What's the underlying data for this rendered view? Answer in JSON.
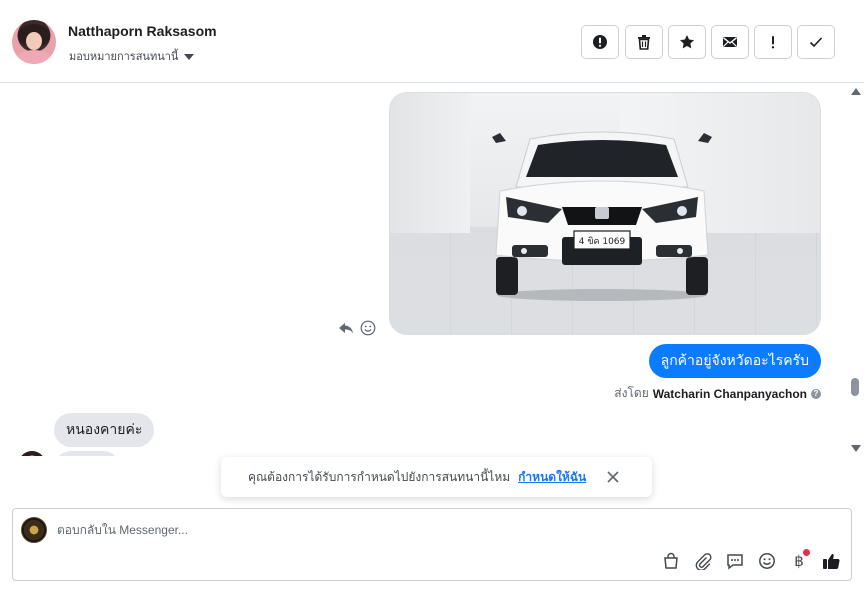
{
  "header": {
    "contact_name": "Natthaporn Raksasom",
    "assign_label": "มอบหมายการสนทนานี้",
    "toolbar": [
      {
        "name": "spam-button",
        "icon": "alert-circle-icon"
      },
      {
        "name": "delete-button",
        "icon": "trash-icon"
      },
      {
        "name": "star-button",
        "icon": "star-icon"
      },
      {
        "name": "mark-unread-button",
        "icon": "envelope-icon"
      },
      {
        "name": "follow-up-button",
        "icon": "exclamation-icon"
      },
      {
        "name": "mark-done-button",
        "icon": "check-icon"
      }
    ]
  },
  "conversation": {
    "outgoing_photo": {
      "plate_text": "4 ขิค 1069"
    },
    "outgoing_text": "ลูกค้าอยู่จังหวัดอะไรครับ",
    "sent_by_prefix": "ส่งโดย",
    "sent_by_agent": "Watcharin Chanpanyachon",
    "incoming_text": "หนองคายค่ะ"
  },
  "toast": {
    "message": "คุณต้องการได้รับการกำหนดไปยังการสนทนานี้ไหม",
    "link": "กำหนดให้ฉัน"
  },
  "composer": {
    "placeholder": "ตอบกลับใน Messenger..."
  },
  "colors": {
    "accent": "#0a7cff",
    "link": "#1877f2",
    "notification_dot": "#f02849"
  }
}
